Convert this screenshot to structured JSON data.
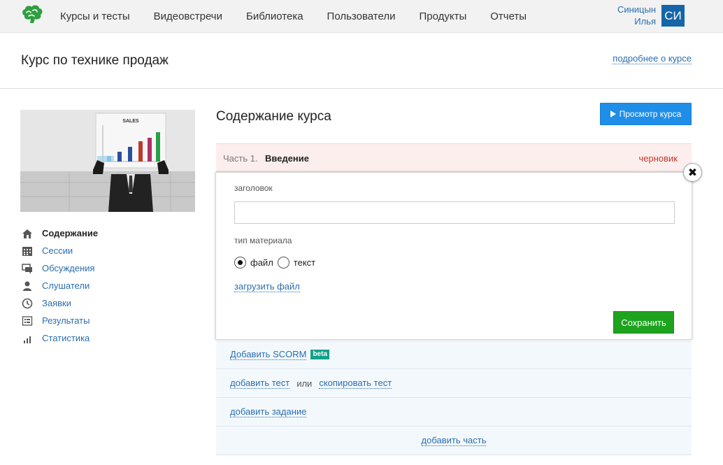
{
  "nav": {
    "items": [
      "Курсы и тесты",
      "Видеовстречи",
      "Библиотека",
      "Пользователи",
      "Продукты",
      "Отчеты"
    ],
    "user_first": "Синицын",
    "user_last": "Илья",
    "avatar_initials": "СИ"
  },
  "course": {
    "title": "Курс по технике продаж",
    "more_link": "подробнее о курсе",
    "cover_chart_label": "SALES"
  },
  "sidebar": {
    "items": [
      {
        "label": "Содержание",
        "icon": "home-icon",
        "active": true
      },
      {
        "label": "Сессии",
        "icon": "calendar-icon"
      },
      {
        "label": "Обсуждения",
        "icon": "chat-icon"
      },
      {
        "label": "Слушатели",
        "icon": "person-icon"
      },
      {
        "label": "Заявки",
        "icon": "clock-icon"
      },
      {
        "label": "Результаты",
        "icon": "list-icon"
      },
      {
        "label": "Статистика",
        "icon": "bar-chart-icon"
      }
    ]
  },
  "main": {
    "title": "Содержание курса",
    "preview_button": "Просмотр курса",
    "part": {
      "number": "Часть 1.",
      "name": "Введение",
      "status": "черновик"
    },
    "editor": {
      "title_label": "заголовок",
      "title_value": "",
      "type_label": "тип материала",
      "option_file": "файл",
      "option_text": "текст",
      "selected": "файл",
      "upload_link": "загрузить файл",
      "save_button": "Сохранить",
      "close_glyph": "✖"
    },
    "add_scorm": "Добавить SCORM",
    "beta_badge": "beta",
    "add_test": "добавить тест",
    "or": "или",
    "copy_test": "скопировать тест",
    "add_task": "добавить задание",
    "add_part": "добавить часть"
  },
  "colors": {
    "accent": "#2a6eb0",
    "preview_button": "#1f8ee8",
    "save_button": "#1ea31e",
    "draft_status": "#c0392b",
    "avatar": "#1565a8",
    "beta_badge": "#14a08a"
  }
}
